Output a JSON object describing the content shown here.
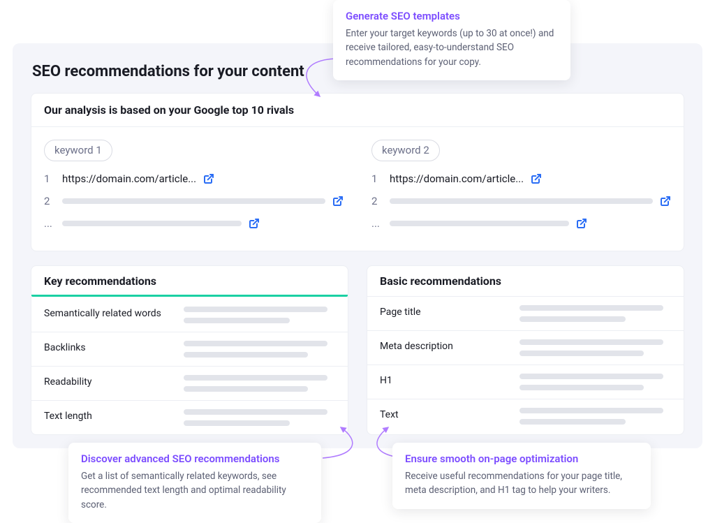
{
  "page": {
    "title": "SEO recommendations for your content"
  },
  "analysis": {
    "header": "Our analysis is based on your Google top 10 rivals",
    "keywords": [
      {
        "chip": "keyword 1",
        "rows": [
          {
            "rank": "1",
            "url": "https://domain.com/article..."
          },
          {
            "rank": "2"
          },
          {
            "rank": "..."
          }
        ]
      },
      {
        "chip": "keyword 2",
        "rows": [
          {
            "rank": "1",
            "url": "https://domain.com/article..."
          },
          {
            "rank": "2"
          },
          {
            "rank": "..."
          }
        ]
      }
    ]
  },
  "key_recs": {
    "header": "Key recommendations",
    "items": [
      "Semantically related words",
      "Backlinks",
      "Readability",
      "Text length"
    ]
  },
  "basic_recs": {
    "header": "Basic recommendations",
    "items": [
      "Page title",
      "Meta description",
      "H1",
      "Text"
    ]
  },
  "callouts": {
    "top": {
      "title": "Generate SEO templates",
      "body": "Enter your target keywords (up to 30 at once!) and receive tailored, easy-to-understand SEO recommendations for your copy."
    },
    "bot_left": {
      "title": "Discover advanced SEO recommendations",
      "body": "Get a list of semantically related keywords, see recommended text length and optimal readability score."
    },
    "bot_right": {
      "title": "Ensure smooth on-page optimization",
      "body": "Receive useful recommendations for your page title, meta description, and H1 tag to help your writers."
    }
  }
}
